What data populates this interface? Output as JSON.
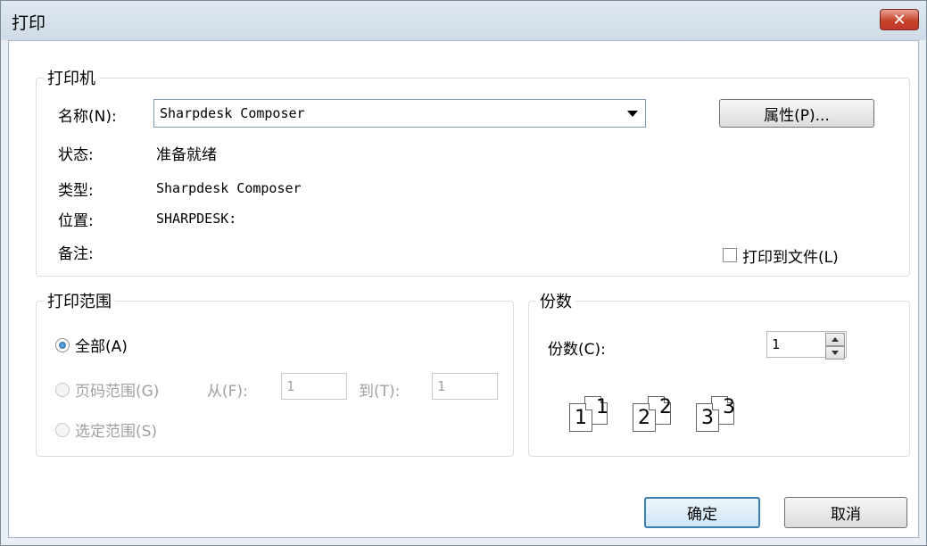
{
  "window": {
    "title": "打印",
    "close_label": "✕"
  },
  "printer": {
    "group_title": "打印机",
    "name_label": "名称(N):",
    "name_value": "Sharpdesk Composer",
    "properties_button": "属性(P)...",
    "status_label": "状态:",
    "status_value": "准备就绪",
    "type_label": "类型:",
    "type_value": "Sharpdesk Composer",
    "location_label": "位置:",
    "location_value": "SHARPDESK:",
    "comment_label": "备注:",
    "print_to_file_label": "打印到文件(L)",
    "print_to_file_checked": false
  },
  "print_range": {
    "group_title": "打印范围",
    "all_label": "全部(A)",
    "all_selected": true,
    "pages_label": "页码范围(G)",
    "from_label": "从(F):",
    "from_value": "1",
    "to_label": "到(T):",
    "to_value": "1",
    "selection_label": "选定范围(S)"
  },
  "copies": {
    "group_title": "份数",
    "copies_label": "份数(C):",
    "copies_value": "1",
    "collate_pages": [
      "1",
      "1",
      "2",
      "2",
      "3",
      "3"
    ]
  },
  "buttons": {
    "ok": "确定",
    "cancel": "取消"
  },
  "colors": {
    "close_button": "#c9432a",
    "default_button_border": "#3c7fb1",
    "radio_dot": "#1d5b93"
  }
}
